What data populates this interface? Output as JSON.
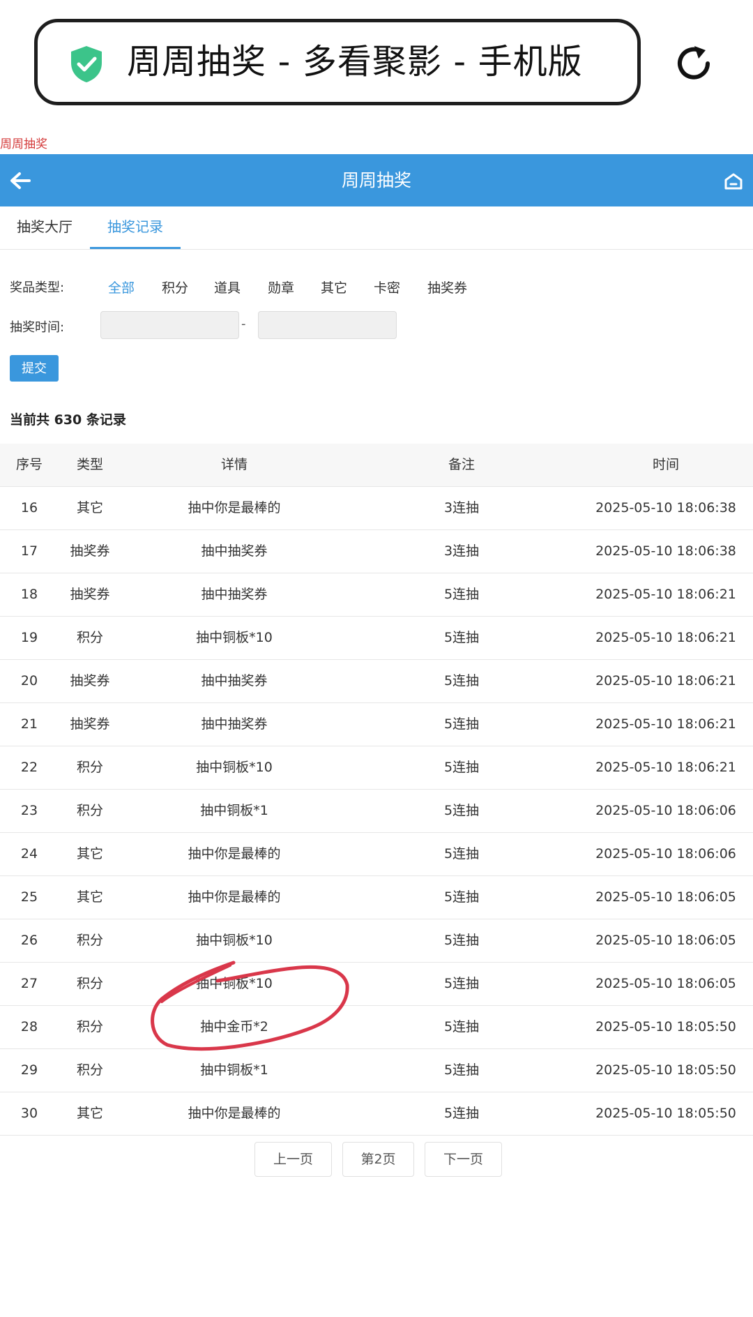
{
  "browser": {
    "title": "周周抽奖 - 多看聚影 - 手机版"
  },
  "page_label": "周周抽奖",
  "header": {
    "title": "周周抽奖"
  },
  "tabs": [
    {
      "label": "抽奖大厅"
    },
    {
      "label": "抽奖记录"
    }
  ],
  "filters": {
    "type_label": "奖品类型:",
    "types": [
      "全部",
      "积分",
      "道具",
      "勋章",
      "其它",
      "卡密",
      "抽奖券"
    ],
    "active_type": "全部",
    "time_label": "抽奖时间:",
    "start_value": "",
    "end_value": "",
    "separator": "-",
    "submit_label": "提交"
  },
  "summary": "当前共 630 条记录",
  "table": {
    "headers": [
      "序号",
      "类型",
      "详情",
      "备注",
      "时间"
    ],
    "rows": [
      [
        "16",
        "其它",
        "抽中你是最棒的",
        "3连抽",
        "2025-05-10 18:06:38"
      ],
      [
        "17",
        "抽奖券",
        "抽中抽奖券",
        "3连抽",
        "2025-05-10 18:06:38"
      ],
      [
        "18",
        "抽奖券",
        "抽中抽奖券",
        "5连抽",
        "2025-05-10 18:06:21"
      ],
      [
        "19",
        "积分",
        "抽中铜板*10",
        "5连抽",
        "2025-05-10 18:06:21"
      ],
      [
        "20",
        "抽奖券",
        "抽中抽奖券",
        "5连抽",
        "2025-05-10 18:06:21"
      ],
      [
        "21",
        "抽奖券",
        "抽中抽奖券",
        "5连抽",
        "2025-05-10 18:06:21"
      ],
      [
        "22",
        "积分",
        "抽中铜板*10",
        "5连抽",
        "2025-05-10 18:06:21"
      ],
      [
        "23",
        "积分",
        "抽中铜板*1",
        "5连抽",
        "2025-05-10 18:06:06"
      ],
      [
        "24",
        "其它",
        "抽中你是最棒的",
        "5连抽",
        "2025-05-10 18:06:06"
      ],
      [
        "25",
        "其它",
        "抽中你是最棒的",
        "5连抽",
        "2025-05-10 18:06:05"
      ],
      [
        "26",
        "积分",
        "抽中铜板*10",
        "5连抽",
        "2025-05-10 18:06:05"
      ],
      [
        "27",
        "积分",
        "抽中铜板*10",
        "5连抽",
        "2025-05-10 18:06:05"
      ],
      [
        "28",
        "积分",
        "抽中金币*2",
        "5连抽",
        "2025-05-10 18:05:50"
      ],
      [
        "29",
        "积分",
        "抽中铜板*1",
        "5连抽",
        "2025-05-10 18:05:50"
      ],
      [
        "30",
        "其它",
        "抽中你是最棒的",
        "5连抽",
        "2025-05-10 18:05:50"
      ]
    ]
  },
  "pagination": {
    "prev": "上一页",
    "current": "第2页",
    "next": "下一页"
  },
  "icons": {
    "shield": "shield-check-icon",
    "reload": "reload-icon",
    "back": "arrow-left-icon",
    "home": "home-icon"
  },
  "colors": {
    "accent": "#3a97dd",
    "shield": "#3cc48a",
    "annotation": "#d9374a",
    "label_red": "#d43b3b"
  }
}
